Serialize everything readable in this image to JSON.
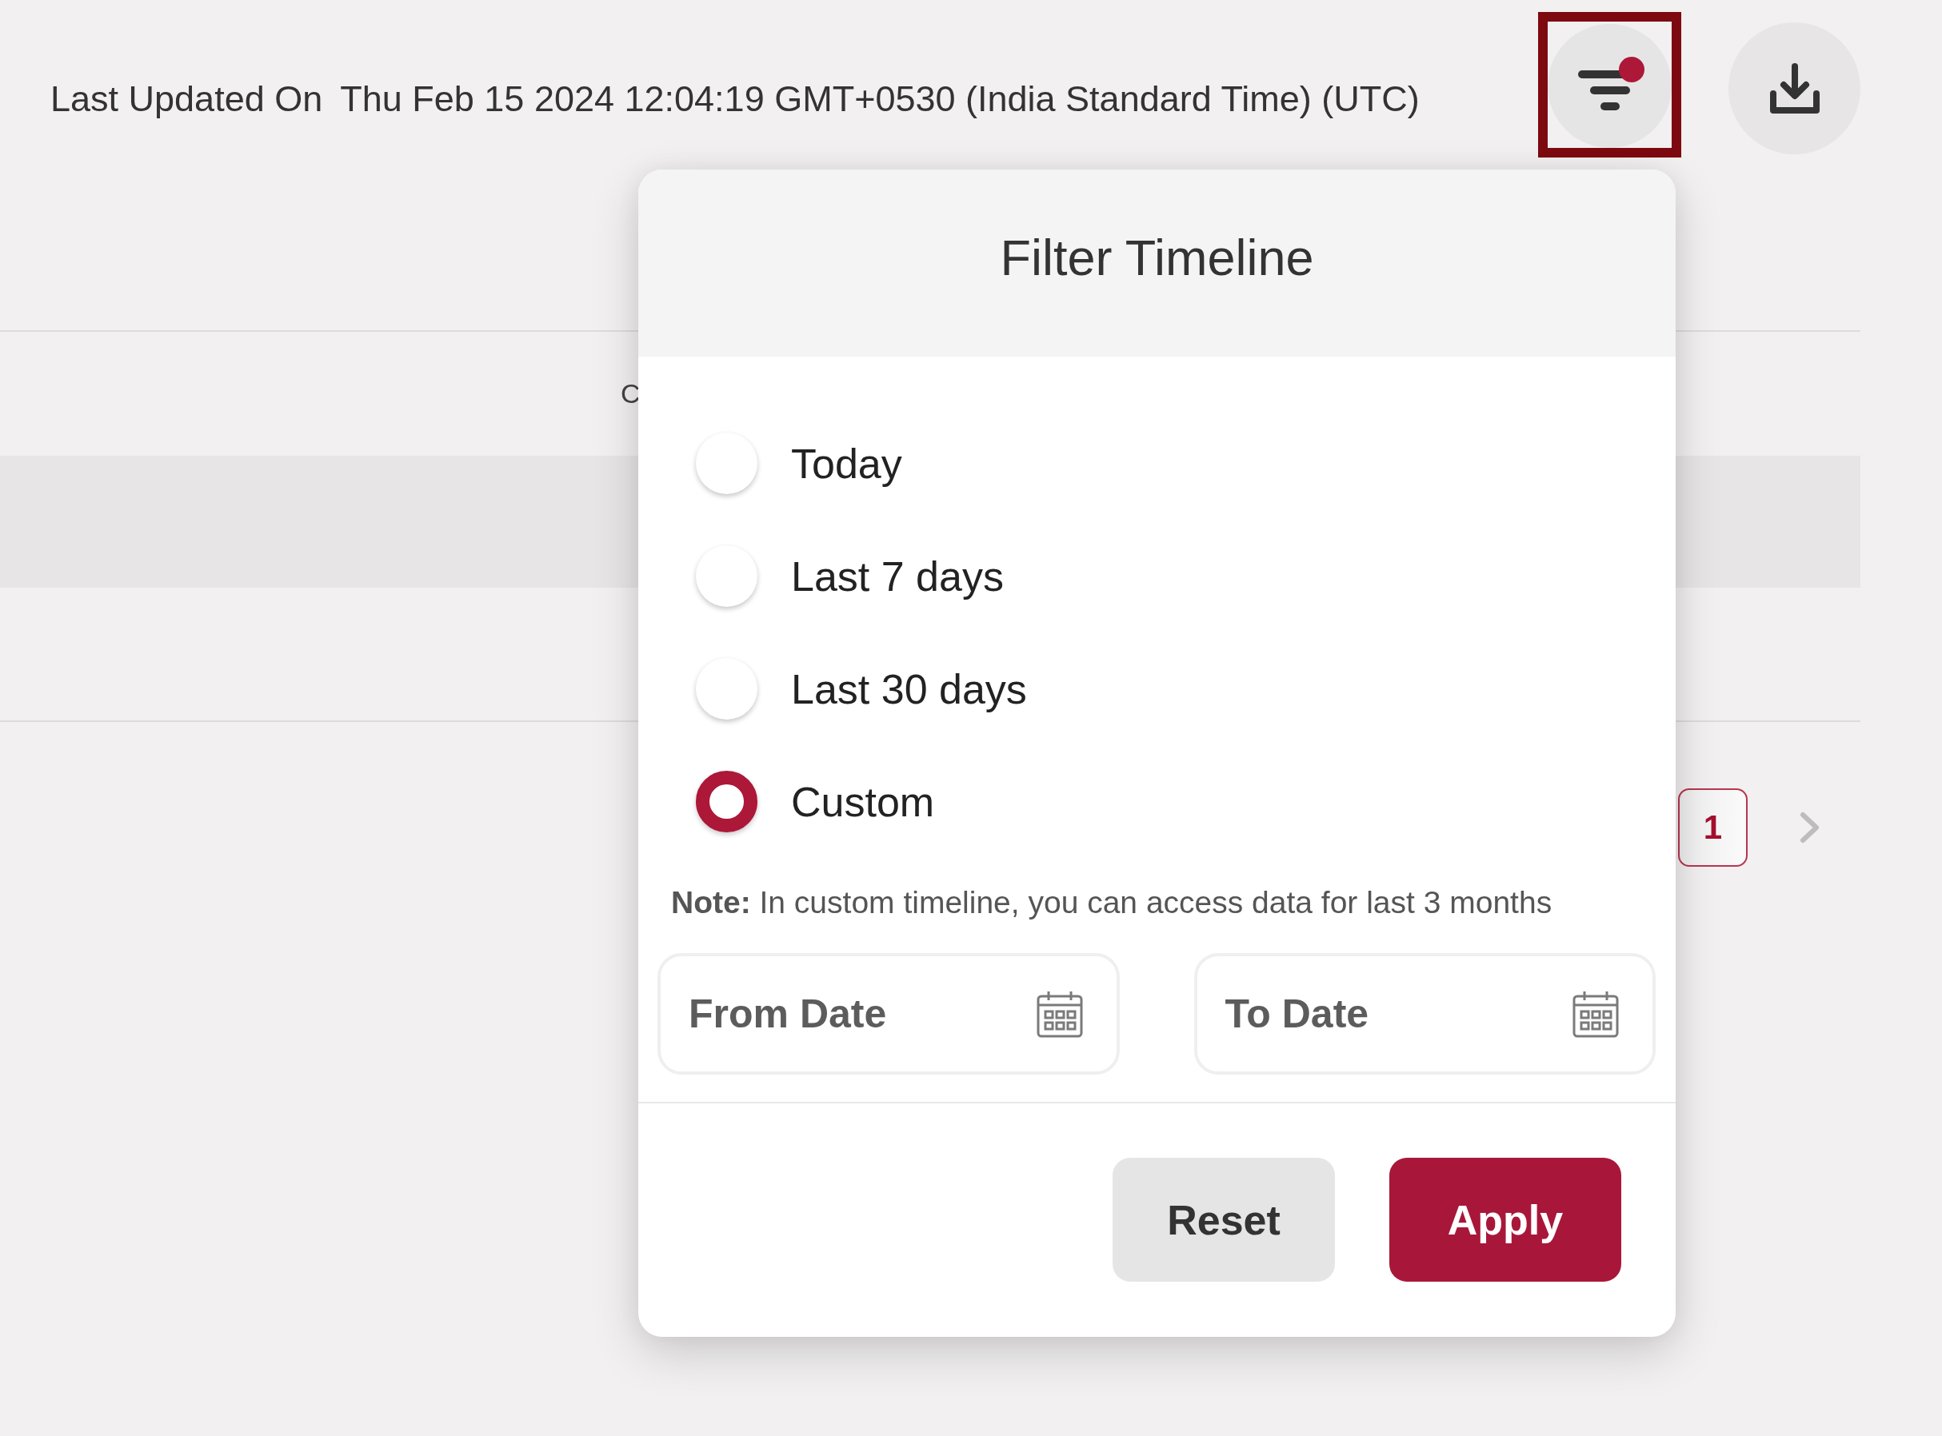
{
  "header": {
    "last_updated_label": "Last Updated On",
    "last_updated_value": "Thu Feb 15 2024 12:04:19 GMT+0530 (India Standard Time) (UTC)",
    "filter_button": {
      "highlighted": true,
      "filter_applied": true
    }
  },
  "table": {
    "column_header": "C",
    "rows": [
      {
        "highlighted": true
      },
      {
        "highlighted": false
      }
    ]
  },
  "pagination": {
    "pages": [
      {
        "label": "1",
        "selected": true
      }
    ]
  },
  "dialog": {
    "title": "Filter Timeline",
    "options": [
      {
        "label": "Today",
        "selected": false
      },
      {
        "label": "Last 7 days",
        "selected": false
      },
      {
        "label": "Last 30 days",
        "selected": false
      },
      {
        "label": "Custom",
        "selected": true
      }
    ],
    "note": "**Note:** In custom timeline, you can access data for last 3 months",
    "from_date": {
      "placeholder": "From Date"
    },
    "to_date": {
      "placeholder": "To Date"
    },
    "buttons": [
      {
        "label": "Reset",
        "kind": "secondary"
      },
      {
        "label": "Apply",
        "kind": "primary"
      }
    ]
  }
}
